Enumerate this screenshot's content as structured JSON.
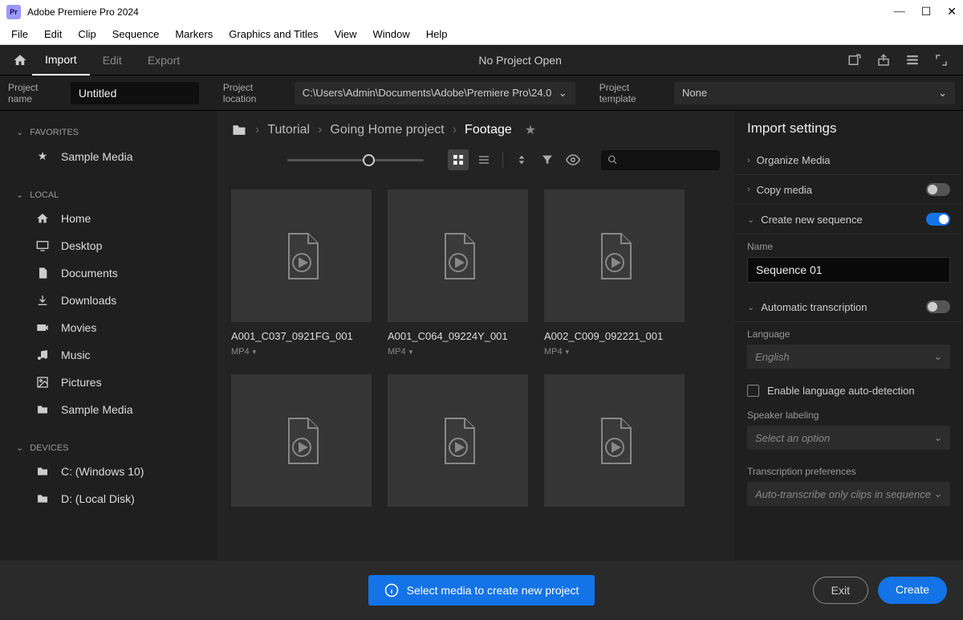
{
  "app": {
    "title": "Adobe Premiere Pro 2024",
    "logo_text": "Pr"
  },
  "menubar": [
    "File",
    "Edit",
    "Clip",
    "Sequence",
    "Markers",
    "Graphics and Titles",
    "View",
    "Window",
    "Help"
  ],
  "topnav": {
    "tabs": [
      "Import",
      "Edit",
      "Export"
    ],
    "active": 0,
    "center": "No Project Open"
  },
  "project": {
    "name_label": "Project name",
    "name_value": "Untitled",
    "location_label": "Project location",
    "location_value": "C:\\Users\\Admin\\Documents\\Adobe\\Premiere Pro\\24.0",
    "template_label": "Project template",
    "template_value": "None"
  },
  "sidebar": {
    "sections": [
      {
        "title": "FAVORITES",
        "items": [
          {
            "icon": "star",
            "label": "Sample Media"
          }
        ]
      },
      {
        "title": "LOCAL",
        "items": [
          {
            "icon": "home",
            "label": "Home"
          },
          {
            "icon": "desktop",
            "label": "Desktop"
          },
          {
            "icon": "document",
            "label": "Documents"
          },
          {
            "icon": "download",
            "label": "Downloads"
          },
          {
            "icon": "movie",
            "label": "Movies"
          },
          {
            "icon": "music",
            "label": "Music"
          },
          {
            "icon": "picture",
            "label": "Pictures"
          },
          {
            "icon": "folder",
            "label": "Sample Media"
          }
        ]
      },
      {
        "title": "DEVICES",
        "items": [
          {
            "icon": "folder",
            "label": "C: (Windows 10)"
          },
          {
            "icon": "folder",
            "label": "D: (Local Disk)"
          }
        ]
      }
    ]
  },
  "breadcrumb": [
    "Tutorial",
    "Going Home project",
    "Footage"
  ],
  "clips": [
    {
      "name": "A001_C037_0921FG_001",
      "format": "MP4"
    },
    {
      "name": "A001_C064_09224Y_001",
      "format": "MP4"
    },
    {
      "name": "A002_C009_092221_001",
      "format": "MP4"
    },
    {
      "name": "",
      "format": ""
    },
    {
      "name": "",
      "format": ""
    },
    {
      "name": "",
      "format": ""
    }
  ],
  "import_settings": {
    "title": "Import settings",
    "organize_media": "Organize Media",
    "copy_media": "Copy media",
    "create_sequence": "Create new sequence",
    "seq_name_label": "Name",
    "seq_name_value": "Sequence 01",
    "auto_trans": "Automatic transcription",
    "language_label": "Language",
    "language_value": "English",
    "auto_detect": "Enable language auto-detection",
    "speaker_label": "Speaker labeling",
    "speaker_placeholder": "Select an option",
    "prefs_label": "Transcription preferences",
    "prefs_value": "Auto-transcribe only clips in sequence"
  },
  "footer": {
    "info": "Select media to create new project",
    "exit": "Exit",
    "create": "Create"
  }
}
